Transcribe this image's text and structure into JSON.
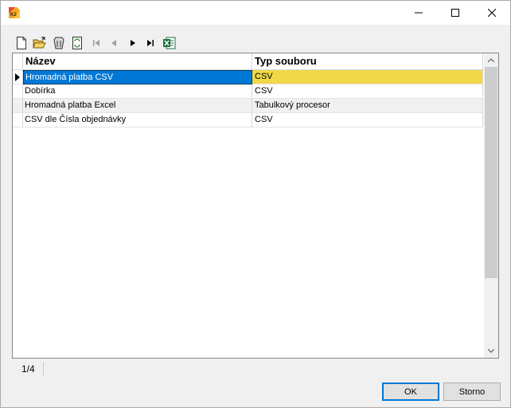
{
  "window": {
    "title": "",
    "controls": [
      "minimize-icon",
      "maximize-icon",
      "close-icon"
    ]
  },
  "toolbar": {
    "buttons": [
      "new-record-icon",
      "open-folder-icon",
      "delete-icon",
      "refresh-icon",
      "first-record-icon",
      "previous-record-icon",
      "next-record-icon",
      "last-record-icon",
      "excel-export-icon"
    ]
  },
  "grid": {
    "columns": [
      "Název",
      "Typ souboru"
    ],
    "rows": [
      {
        "name": "Hromadná platba CSV",
        "type": "CSV",
        "selected": true
      },
      {
        "name": "Dobírka",
        "type": "CSV"
      },
      {
        "name": "Hromadná platba Excel",
        "type": "Tabulkový procesor"
      },
      {
        "name": "CSV dle Čísla objednávky",
        "type": "CSV"
      }
    ]
  },
  "status": {
    "position": "1/4"
  },
  "buttons": {
    "ok": "OK",
    "cancel": "Storno"
  },
  "colors": {
    "selection": "#0078d7",
    "highlight_cell": "#f0d848",
    "default_button_border": "#0078d7"
  }
}
